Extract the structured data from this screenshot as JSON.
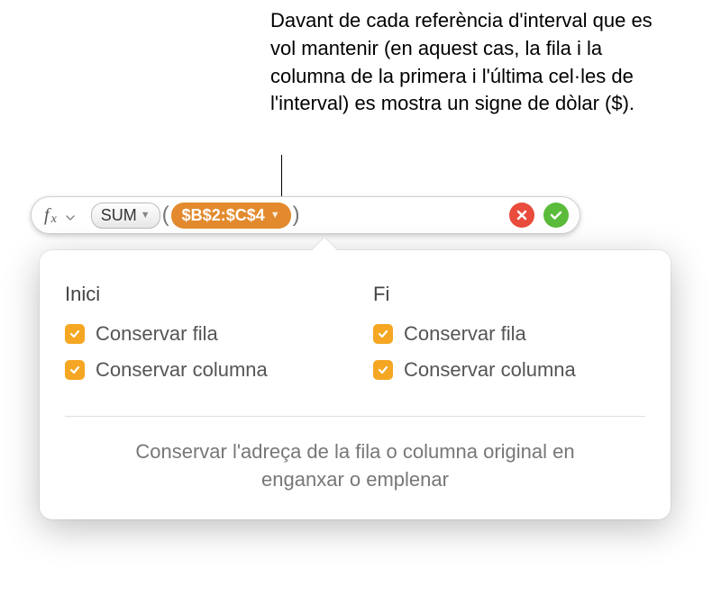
{
  "annotation": "Davant de cada referència d'interval que es vol mantenir (en aquest cas, la fila i la columna de la primera i l'última cel·les de l'interval) es mostra un signe de dòlar ($).",
  "formula_bar": {
    "fx_label": "f",
    "fx_sub": "x",
    "function_name": "SUM",
    "range_ref": "$B$2:$C$4"
  },
  "popover": {
    "start": {
      "header": "Inici",
      "preserve_row": "Conservar fila",
      "preserve_col": "Conservar columna"
    },
    "end": {
      "header": "Fi",
      "preserve_row": "Conservar fila",
      "preserve_col": "Conservar columna"
    },
    "footer": "Conservar l'adreça de la fila o columna original en enganxar o emplenar"
  }
}
